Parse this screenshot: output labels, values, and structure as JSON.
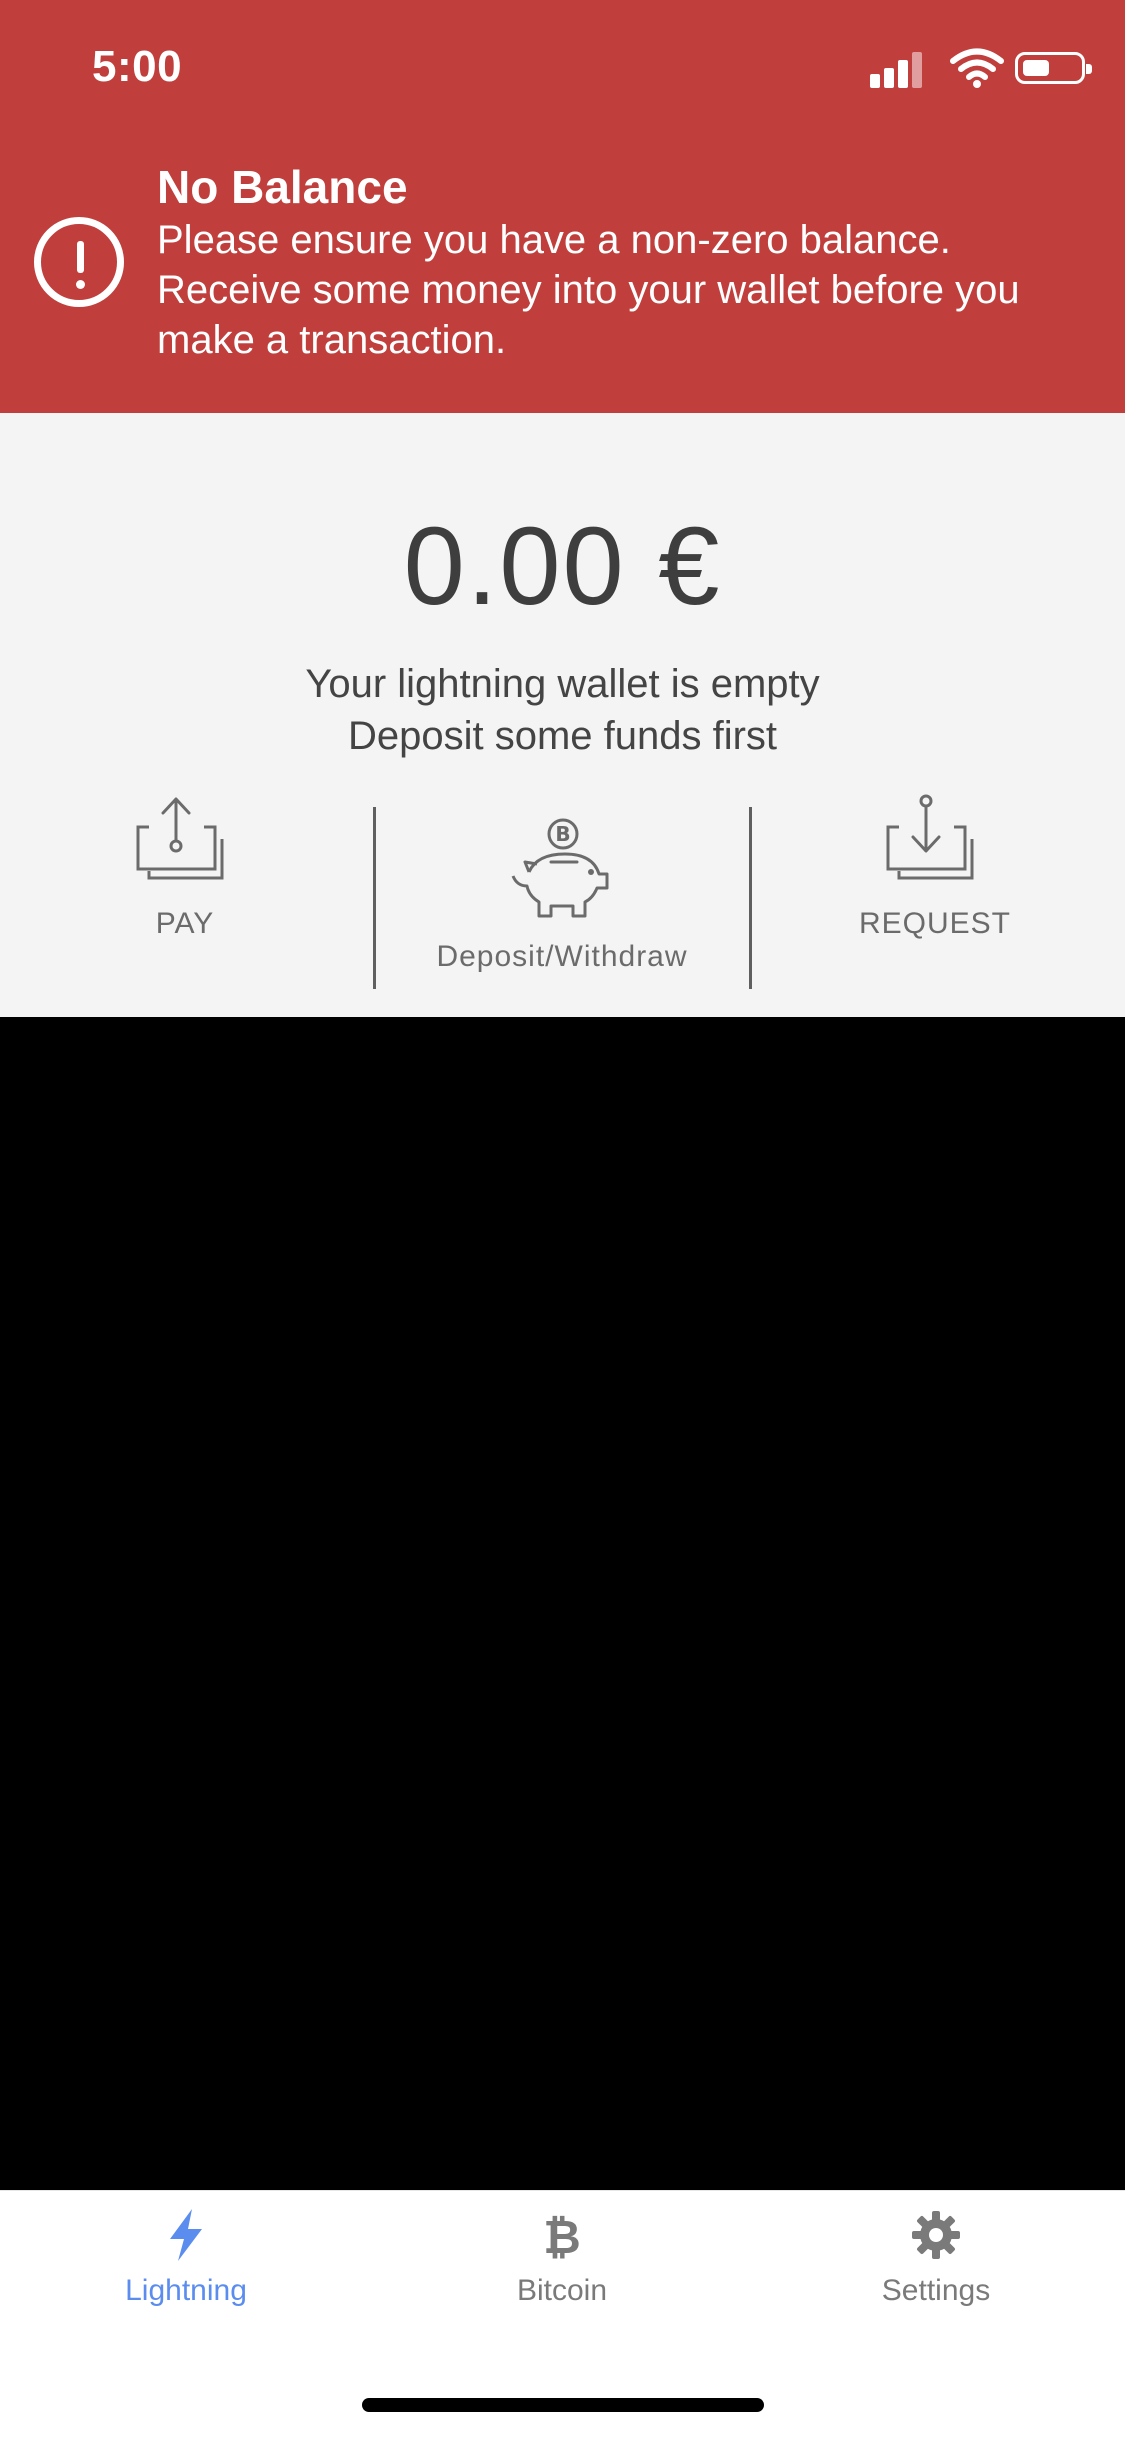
{
  "status_bar": {
    "time": "5:00"
  },
  "alert": {
    "title": "No Balance",
    "message": "Please ensure you have a non-zero balance. Receive some money into your wallet before you make a transaction.",
    "icon": "exclamation-circle-icon",
    "background": "#C03F3C"
  },
  "balance": {
    "amount": "0.00 €",
    "empty_line1": "Your lightning wallet is empty",
    "empty_line2": "Deposit some funds first"
  },
  "actions": [
    {
      "label": "PAY",
      "icon": "upload-tray-icon"
    },
    {
      "label": "Deposit/Withdraw",
      "icon": "piggy-bank-bitcoin-icon"
    },
    {
      "label": "REQUEST",
      "icon": "download-tray-icon"
    }
  ],
  "tabs": [
    {
      "label": "Lightning",
      "icon": "lightning-icon",
      "active": true,
      "color": "#5B8DEF"
    },
    {
      "label": "Bitcoin",
      "icon": "bitcoin-icon",
      "active": false,
      "color": "#7A7A7A"
    },
    {
      "label": "Settings",
      "icon": "gear-icon",
      "active": false,
      "color": "#7A7A7A"
    }
  ]
}
